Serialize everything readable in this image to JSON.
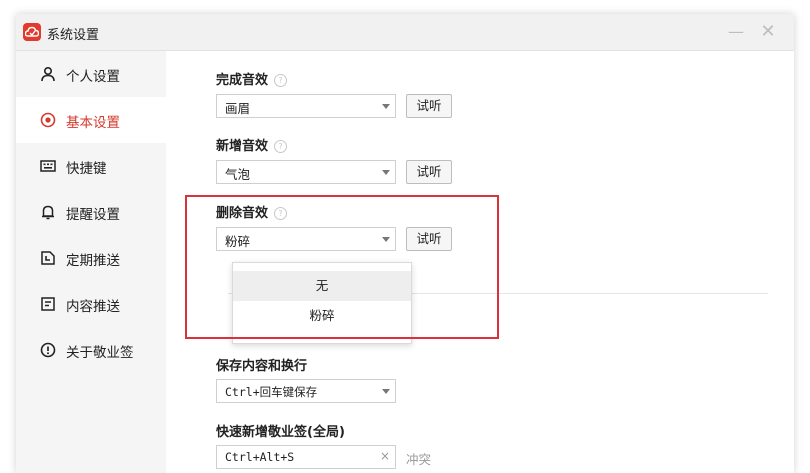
{
  "window": {
    "title": "系统设置",
    "minimize_glyph": "—",
    "close_glyph": "✕"
  },
  "sidebar": {
    "items": [
      {
        "label": "个人设置",
        "icon": "person-icon",
        "active": false
      },
      {
        "label": "基本设置",
        "icon": "target-icon",
        "active": true
      },
      {
        "label": "快捷键",
        "icon": "keyboard-icon",
        "active": false
      },
      {
        "label": "提醒设置",
        "icon": "bell-icon",
        "active": false
      },
      {
        "label": "定期推送",
        "icon": "calendar-icon",
        "active": false
      },
      {
        "label": "内容推送",
        "icon": "document-icon",
        "active": false
      },
      {
        "label": "关于敬业签",
        "icon": "info-icon",
        "active": false
      }
    ]
  },
  "sections": {
    "complete_sound": {
      "label": "完成音效",
      "value": "画眉",
      "button": "试听"
    },
    "new_sound": {
      "label": "新增音效",
      "value": "气泡",
      "button": "试听"
    },
    "delete_sound": {
      "label": "删除音效",
      "value": "粉碎",
      "button": "试听"
    },
    "save_content": {
      "label": "保存内容和换行",
      "value": "Ctrl+回车键保存"
    },
    "quick_add": {
      "label": "快速新增敬业签(全局)",
      "value": "Ctrl+Alt+S",
      "clear": "×",
      "status": "冲突"
    }
  },
  "dropdown": {
    "options": [
      "无",
      "粉碎"
    ],
    "hovered_index": 0
  },
  "help_glyph": "?",
  "colors": {
    "accent": "#d63a2d",
    "highlight_border": "#d9333a",
    "sidebar_bg": "#f5f5f5"
  }
}
